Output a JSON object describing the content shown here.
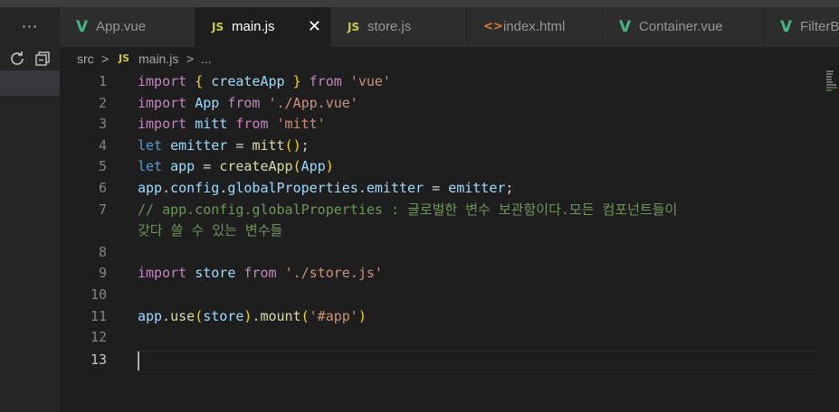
{
  "sidebar": {
    "more_label": "···"
  },
  "tabs": [
    {
      "icon": "vue-icon",
      "glyph": "V",
      "label": "App.vue",
      "active": false
    },
    {
      "icon": "js-icon",
      "glyph": "JS",
      "label": "main.js",
      "active": true,
      "close": "✕"
    },
    {
      "icon": "js-icon",
      "glyph": "JS",
      "label": "store.js",
      "active": false
    },
    {
      "icon": "html-icon",
      "glyph": "<>",
      "label": "index.html",
      "active": false
    },
    {
      "icon": "vue-icon",
      "glyph": "V",
      "label": "Container.vue",
      "active": false
    },
    {
      "icon": "vue-icon",
      "glyph": "V",
      "label": "FilterB",
      "active": false
    }
  ],
  "breadcrumb": {
    "folder": "src",
    "sep": ">",
    "file_icon": "JS",
    "file": "main.js",
    "more": "..."
  },
  "editor": {
    "line_numbers": [
      "1",
      "2",
      "3",
      "4",
      "5",
      "6",
      "7",
      "",
      "8",
      "9",
      "10",
      "11",
      "12",
      "13"
    ],
    "current_line": "13",
    "lines": [
      "import { createApp } from 'vue'",
      "import App from './App.vue'",
      "import mitt from 'mitt'",
      "let emitter = mitt();",
      "let app = createApp(App)",
      "app.config.globalProperties.emitter = emitter;",
      "// app.config.globalProperties : 글로벌한 변수 보관함이다.모든 컴포넌트들이",
      "갖다 쓸 수 있는 변수들",
      "",
      "import store from './store.js'",
      "",
      "app.use(store).mount('#app')",
      "",
      ""
    ]
  },
  "colors": {
    "background": "#1e1e1e",
    "keyword": "#c586c0",
    "function": "#dcdcaa",
    "variable": "#9cdcfe",
    "string": "#ce9178",
    "comment": "#6a9955"
  }
}
